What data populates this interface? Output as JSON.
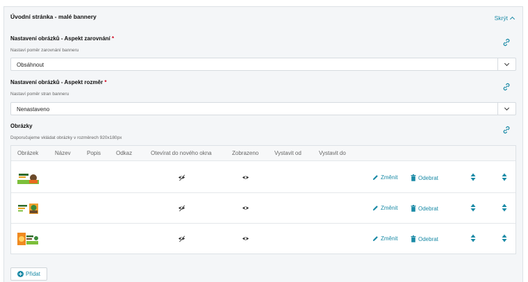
{
  "section": {
    "title": "Úvodní stránka - malé bannery",
    "toggle_label": "Skrýt"
  },
  "fields": [
    {
      "label": "Nastavení obrázků - Aspekt zarovnání",
      "required_mark": "*",
      "hint": "Nastaví poměr zarovnání banneru",
      "value": "Obsáhnout"
    },
    {
      "label": "Nastavení obrázků - Aspekt rozměr",
      "required_mark": "*",
      "hint": "Nastaví poměr stran banneru",
      "value": "Nenastaveno"
    }
  ],
  "images": {
    "label": "Obrázky",
    "hint": "Doporučujeme vkládat obrázky v rozměrech 920x180px",
    "columns": [
      "Obrázek",
      "Název",
      "Popis",
      "Odkaz",
      "Otevírat do nového okna",
      "Zobrazeno",
      "Vystavit od",
      "Vystavit do"
    ],
    "rows": [
      {
        "change": "Změnit",
        "remove": "Odebrat"
      },
      {
        "change": "Změnit",
        "remove": "Odebrat"
      },
      {
        "change": "Změnit",
        "remove": "Odebrat"
      }
    ]
  },
  "add_button": {
    "label": "Přidat"
  },
  "colors": {
    "accent": "#1a8aa6",
    "required": "#d0021b",
    "panel_bg": "#f4f6f8"
  }
}
